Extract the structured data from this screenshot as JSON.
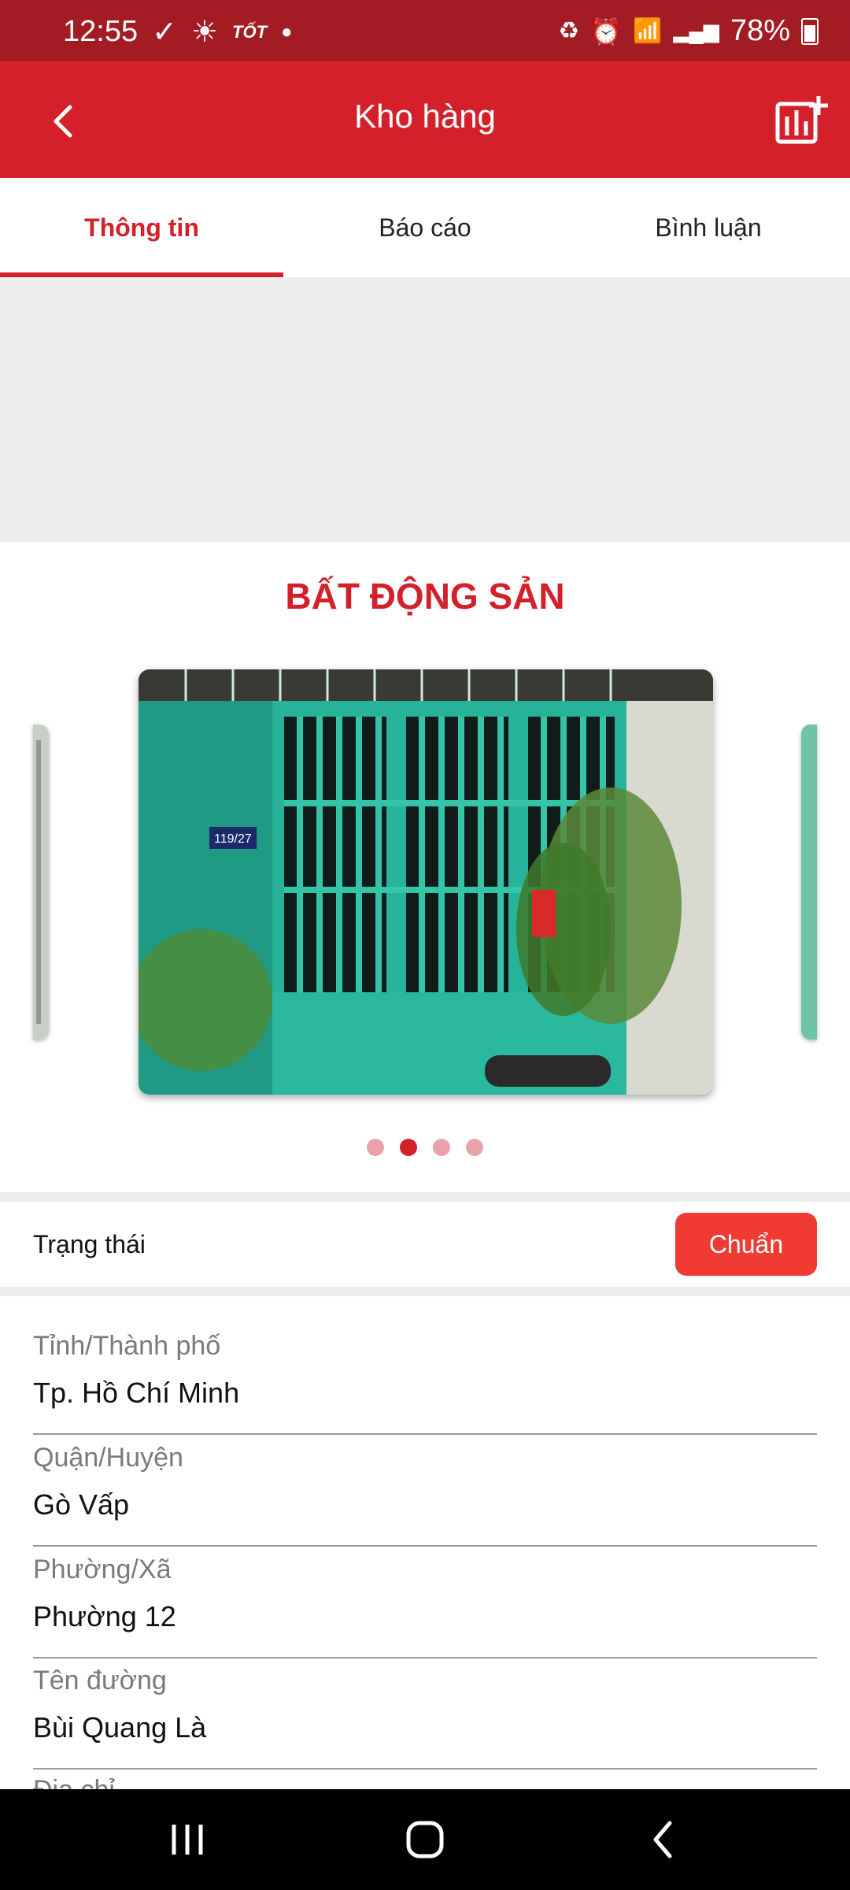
{
  "status_bar": {
    "time": "12:55",
    "carrier_tag": "TỐT",
    "battery": "78%"
  },
  "app_bar": {
    "title": "Kho hàng"
  },
  "tabs": [
    {
      "label": "Thông tin",
      "active": true
    },
    {
      "label": "Báo cáo",
      "active": false
    },
    {
      "label": "Bình luận",
      "active": false
    }
  ],
  "section": {
    "title": "BẤT ĐỘNG SẢN"
  },
  "carousel": {
    "total": 4,
    "active_index": 2,
    "house_number": "119/27"
  },
  "status_row": {
    "label": "Trạng thái",
    "value": "Chuẩn"
  },
  "fields": [
    {
      "label": "Tỉnh/Thành phố",
      "value": "Tp. Hồ Chí Minh"
    },
    {
      "label": "Quận/Huyện",
      "value": "Gò Vấp"
    },
    {
      "label": "Phường/Xã",
      "value": "Phường 12"
    },
    {
      "label": "Tên đường",
      "value": "Bùi Quang Là"
    }
  ],
  "partial_field_label": "Địa chỉ",
  "colors": {
    "primary": "#d4202a",
    "status_bar": "#a31c24",
    "button": "#ef3b33"
  }
}
